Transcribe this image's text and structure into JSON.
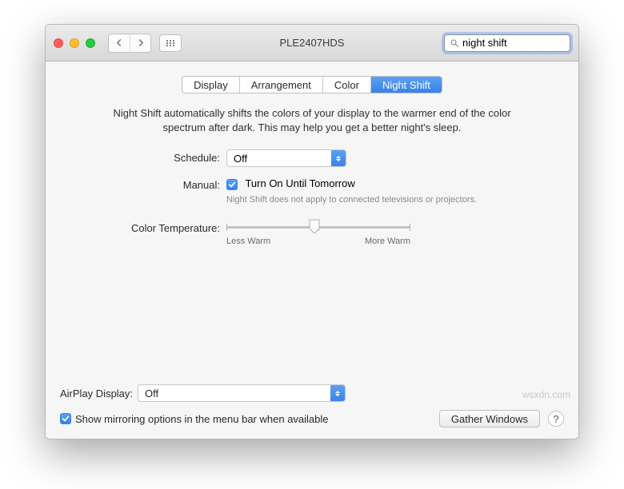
{
  "window": {
    "title": "PLE2407HDS"
  },
  "search": {
    "value": "night shift"
  },
  "tabs": [
    {
      "label": "Display"
    },
    {
      "label": "Arrangement"
    },
    {
      "label": "Color"
    },
    {
      "label": "Night Shift"
    }
  ],
  "active_tab": 3,
  "description": "Night Shift automatically shifts the colors of your display to the warmer end of the color spectrum after dark. This may help you get a better night's sleep.",
  "schedule": {
    "label": "Schedule:",
    "value": "Off"
  },
  "manual": {
    "label": "Manual:",
    "checkbox_label": "Turn On Until Tomorrow",
    "checked": true,
    "note": "Night Shift does not apply to connected televisions or projectors."
  },
  "color_temp": {
    "label": "Color Temperature:",
    "left": "Less Warm",
    "right": "More Warm",
    "value_pct": 48
  },
  "airplay": {
    "label": "AirPlay Display:",
    "value": "Off"
  },
  "mirroring": {
    "checked": true,
    "label": "Show mirroring options in the menu bar when available"
  },
  "gather": {
    "label": "Gather Windows"
  },
  "watermark": "wsxdn.com"
}
